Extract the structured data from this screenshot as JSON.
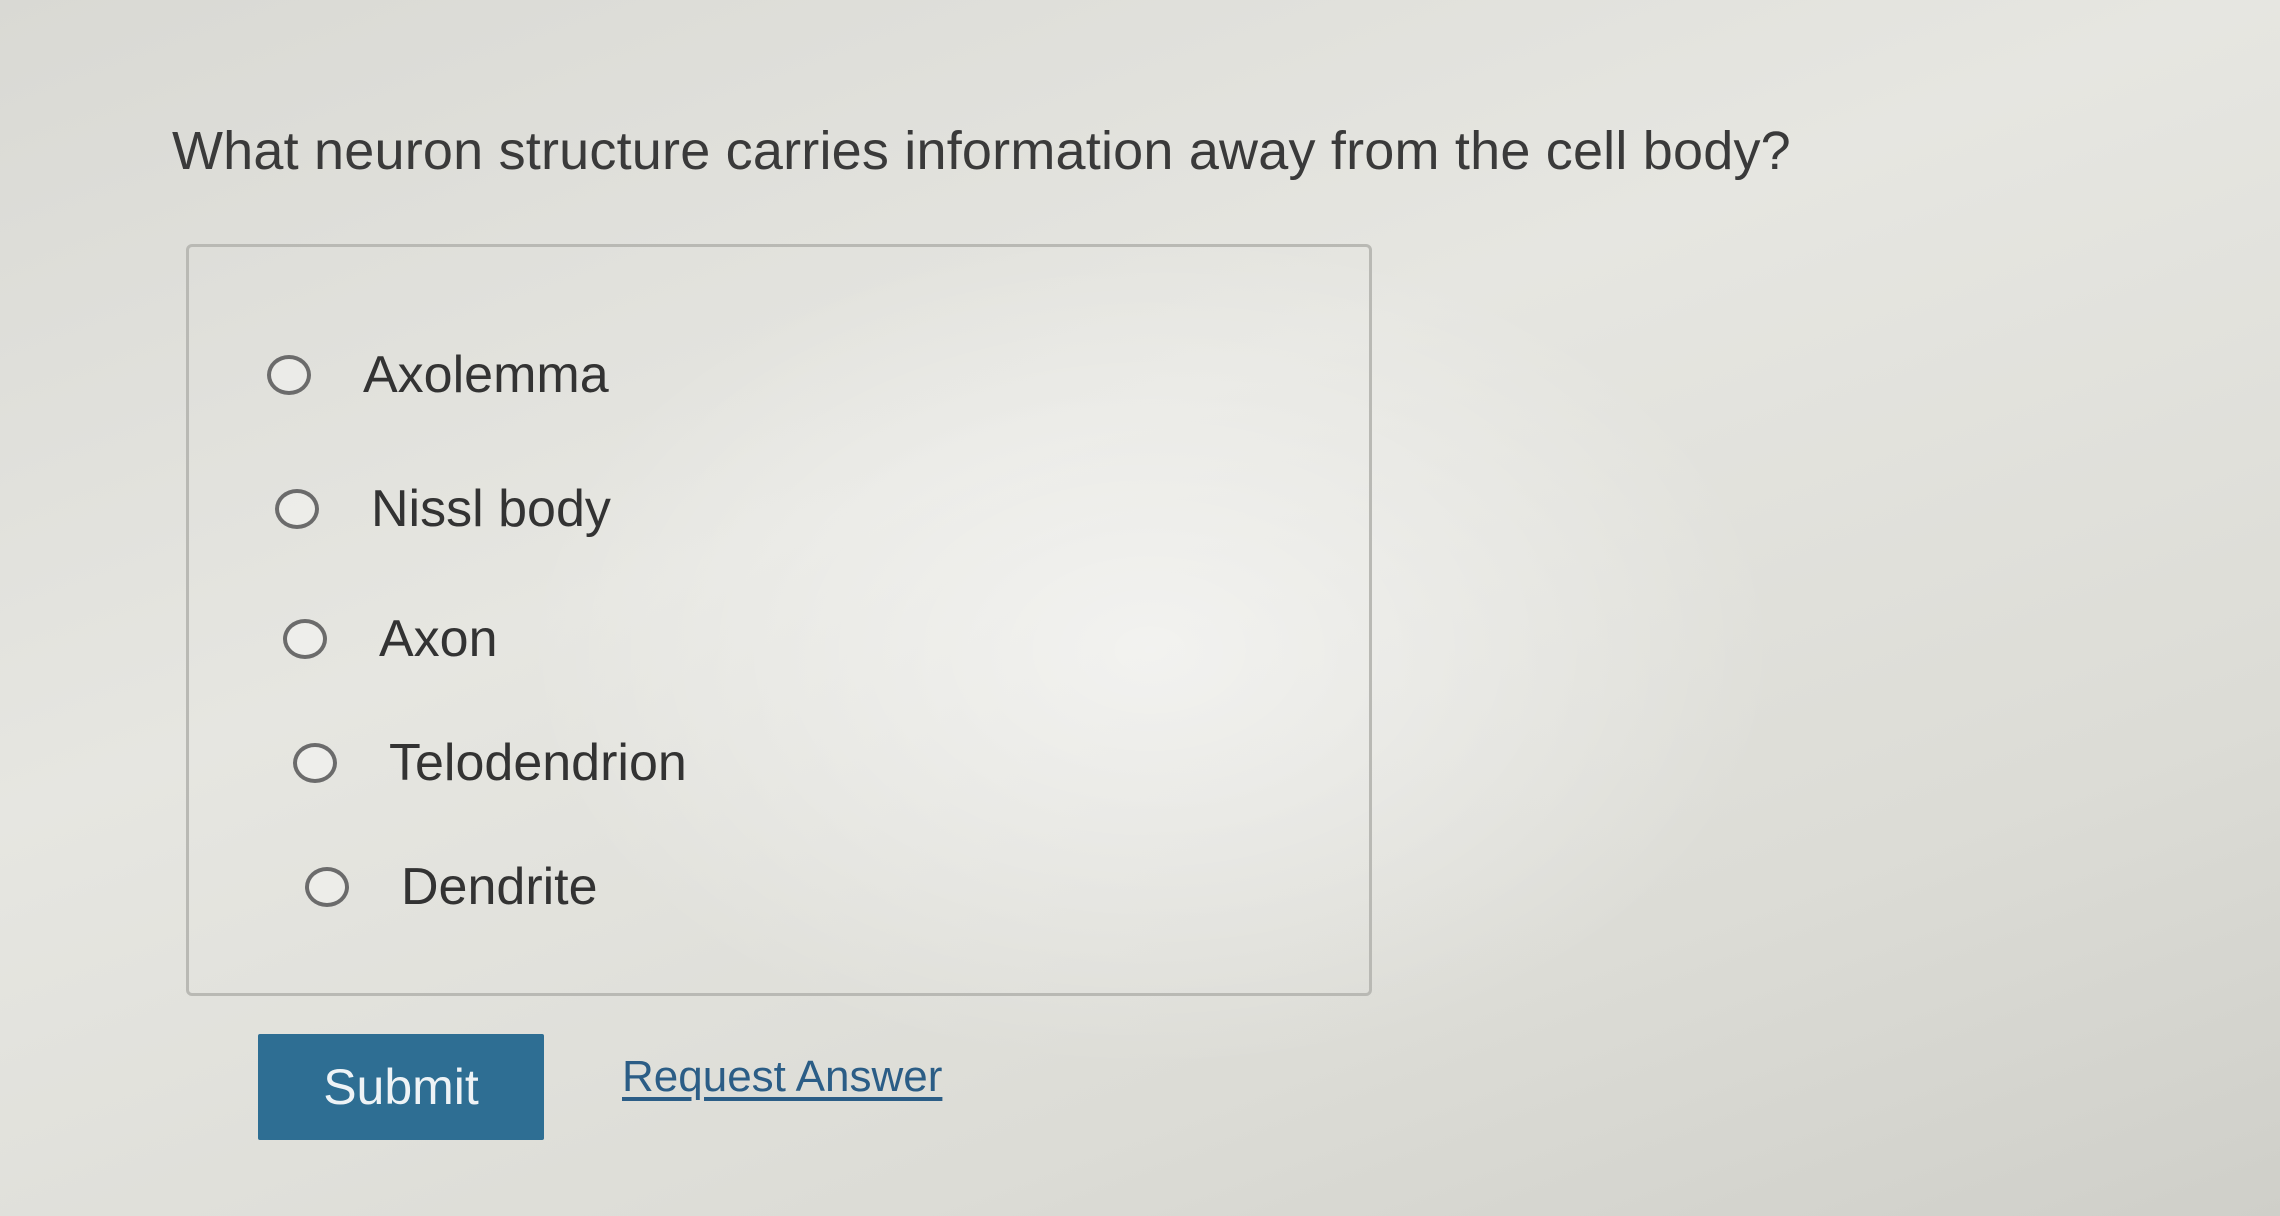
{
  "question": {
    "text": "What neuron structure carries information away from the cell body?"
  },
  "choices": [
    {
      "label": "Axolemma"
    },
    {
      "label": "Nissl body"
    },
    {
      "label": "Axon"
    },
    {
      "label": "Telodendrion"
    },
    {
      "label": "Dendrite"
    }
  ],
  "actions": {
    "submit_label": "Submit",
    "request_answer_label": "Request Answer"
  },
  "colors": {
    "submit_button": "#2e6e93",
    "link": "#2b5d86",
    "text": "#333333"
  }
}
